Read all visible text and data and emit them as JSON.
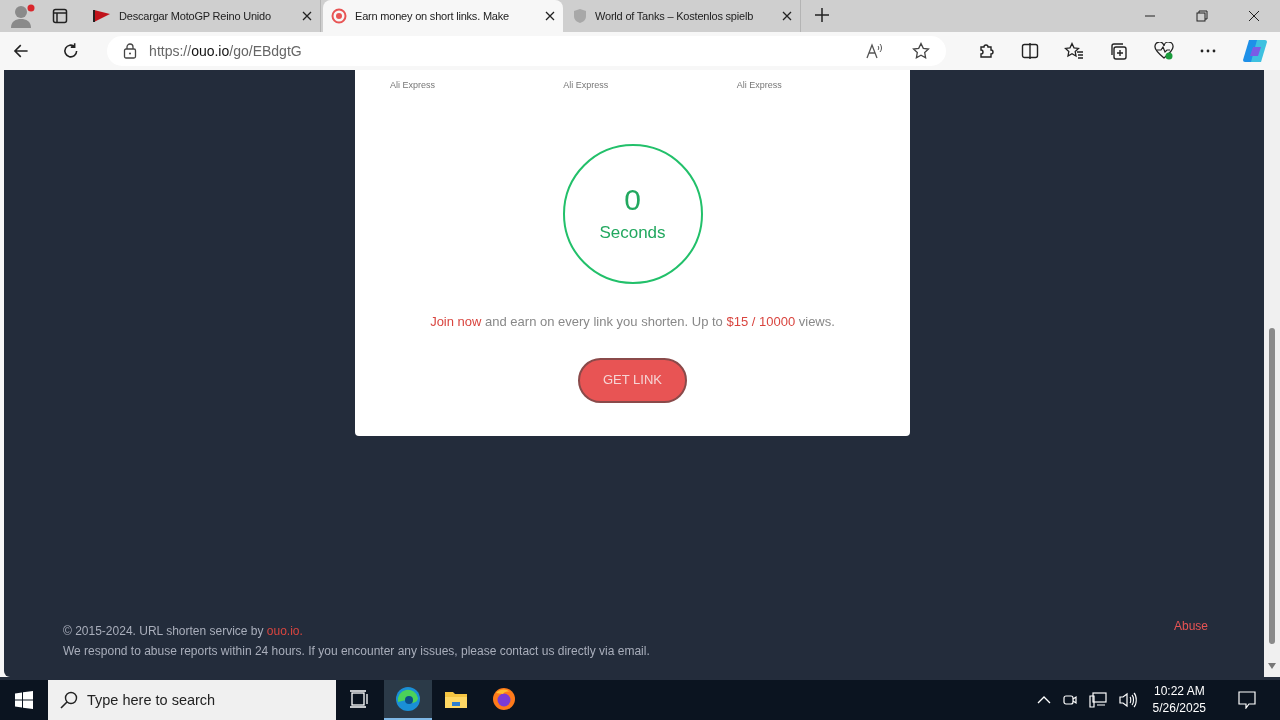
{
  "browser": {
    "tabs": [
      {
        "title": "Descargar MotoGP Reino Unido",
        "kind": "flag",
        "selected": false
      },
      {
        "title": "Earn money on short links. Make",
        "kind": "target",
        "selected": true
      },
      {
        "title": "World of Tanks – Kostenlos spielb",
        "kind": "shield",
        "selected": false
      }
    ],
    "address": {
      "scheme": "https://",
      "host": "ouo.io",
      "path": "/go/EBdgtG"
    }
  },
  "page": {
    "ad_labels": [
      "Ali Express",
      "Ali Express",
      "Ali Express"
    ],
    "countdown": {
      "value": "0",
      "unit": "Seconds"
    },
    "promo": [
      {
        "kind": "link",
        "text": "Join now"
      },
      {
        "kind": "plain",
        "text": " and earn on every link you shorten. Up to "
      },
      {
        "kind": "highlight",
        "text": "$15 / 10000"
      },
      {
        "kind": "plain",
        "text": " views."
      }
    ],
    "button": "GET LINK",
    "footer": {
      "copyright": [
        {
          "kind": "plain",
          "text": "© 2015-2024. URL shorten service by "
        },
        {
          "kind": "link",
          "text": "ouo.io."
        }
      ],
      "notice": "We respond to abuse reports within 24 hours. If you encounter any issues, please contact us directly via email.",
      "abuse_link": "Abuse"
    }
  },
  "taskbar": {
    "search": {
      "placeholder": "Type here to search"
    },
    "apps": [
      {
        "kind": "taskview",
        "selected": false
      },
      {
        "kind": "edge",
        "selected": true
      },
      {
        "kind": "folder",
        "selected": false
      },
      {
        "kind": "firefox",
        "selected": false
      }
    ],
    "time": "10:22 AM",
    "date": "5/26/2025"
  }
}
